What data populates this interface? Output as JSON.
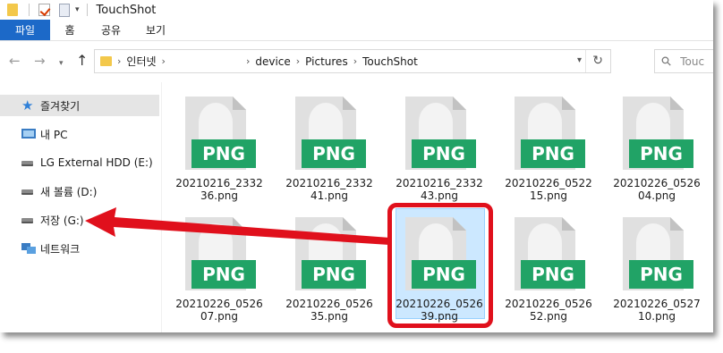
{
  "window": {
    "title": "TouchShot"
  },
  "ribbon": {
    "tabs": [
      "파일",
      "홈",
      "공유",
      "보기"
    ]
  },
  "address": {
    "crumbs": [
      "인터넷",
      "device",
      "Pictures",
      "TouchShot"
    ],
    "search_placeholder": "Touc"
  },
  "sidebar": {
    "items": [
      {
        "label": "즐겨찾기",
        "icon": "star-icon"
      },
      {
        "label": "내 PC",
        "icon": "pc-icon"
      },
      {
        "label": "LG External HDD (E:)",
        "icon": "drive-icon"
      },
      {
        "label": "새 볼륨 (D:)",
        "icon": "drive-icon"
      },
      {
        "label": "저장 (G:)",
        "icon": "drive-icon"
      },
      {
        "label": "네트워크",
        "icon": "network-icon"
      }
    ]
  },
  "files": [
    {
      "line1": "20210216_2332",
      "line2": "36.png",
      "badge": "PNG"
    },
    {
      "line1": "20210216_2332",
      "line2": "41.png",
      "badge": "PNG"
    },
    {
      "line1": "20210216_2332",
      "line2": "43.png",
      "badge": "PNG"
    },
    {
      "line1": "20210226_0522",
      "line2": "15.png",
      "badge": "PNG"
    },
    {
      "line1": "20210226_0526",
      "line2": "04.png",
      "badge": "PNG"
    },
    {
      "line1": "20210226_0526",
      "line2": "07.png",
      "badge": "PNG"
    },
    {
      "line1": "20210226_0526",
      "line2": "35.png",
      "badge": "PNG"
    },
    {
      "line1": "20210226_0526",
      "line2": "39.png",
      "badge": "PNG"
    },
    {
      "line1": "20210226_0526",
      "line2": "52.png",
      "badge": "PNG"
    },
    {
      "line1": "20210226_0527",
      "line2": "10.png",
      "badge": "PNG"
    }
  ],
  "colors": {
    "accent": "#1c69c8",
    "badge": "#21a366",
    "annotation": "#e0101c"
  }
}
